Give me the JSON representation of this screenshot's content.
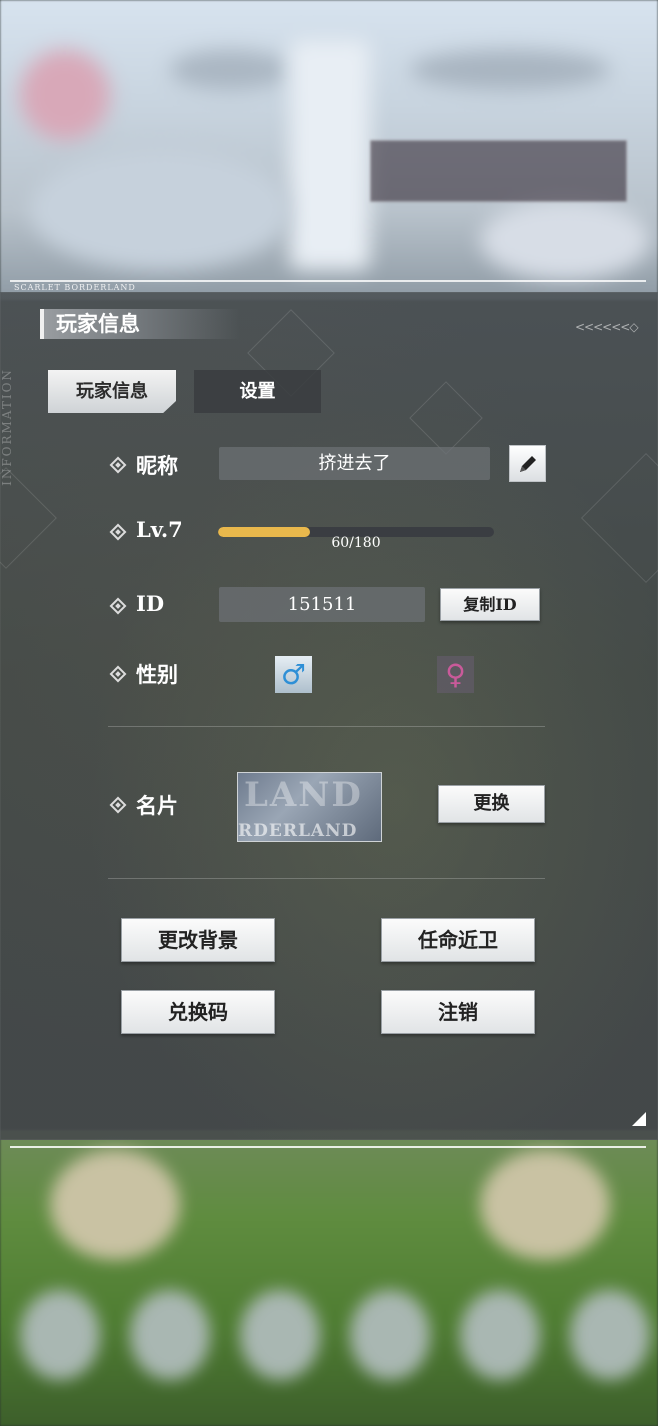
{
  "background": {
    "top_caption": "SCARLET BORDERLAND"
  },
  "panel": {
    "title": "玩家信息",
    "side_caption": "INFORMATION",
    "arrows": "<<<<<<◇"
  },
  "tabs": [
    {
      "label": "玩家信息",
      "active": true
    },
    {
      "label": "设置",
      "active": false
    }
  ],
  "rows": {
    "nickname": {
      "label": "昵称",
      "value": "挤进去了",
      "edit_icon": "pencil-icon"
    },
    "level": {
      "label": "Lv.7",
      "progress_text": "60/180",
      "current": 60,
      "max": 180
    },
    "id": {
      "label": "ID",
      "value": "151511",
      "copy_button": "复制ID"
    },
    "gender": {
      "label": "性别",
      "male_icon": "male-icon",
      "female_icon": "female-icon",
      "selected": "male"
    },
    "card": {
      "label": "名片",
      "card_text_top": "LAND",
      "card_text_bottom": "RDERLAND",
      "change_button": "更换"
    }
  },
  "actions": {
    "change_background": "更改背景",
    "appoint_guard": "任命近卫",
    "redeem_code": "兑换码",
    "logout": "注销"
  },
  "colors": {
    "progress_fill": "#e9b84c",
    "male": "#2e8fd6",
    "female": "#c95a9a"
  }
}
